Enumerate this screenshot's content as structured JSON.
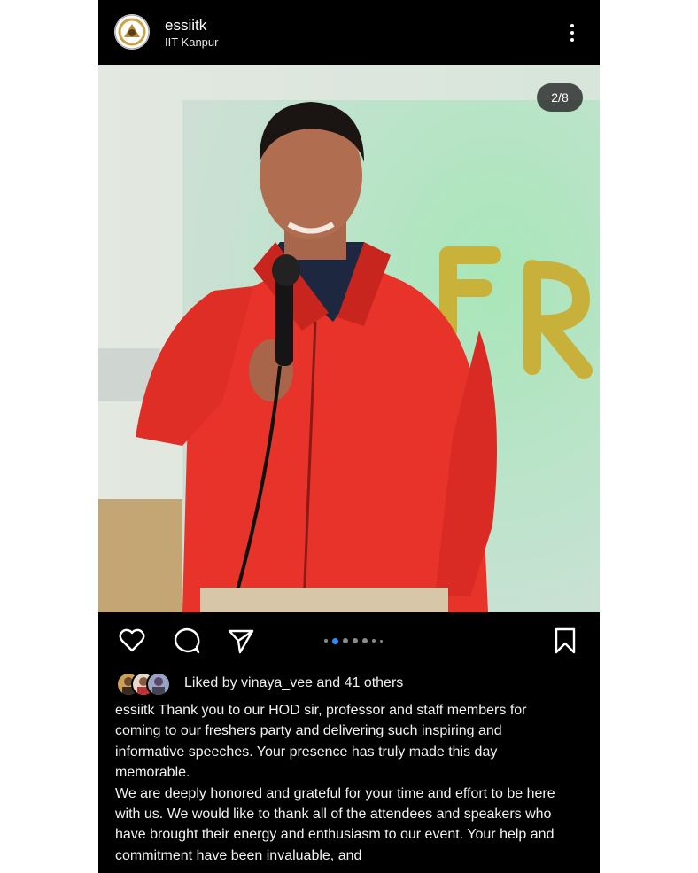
{
  "post": {
    "username": "essiitk",
    "location": "IIT Kanpur",
    "slide_counter": "2/8",
    "carousel": {
      "total": 8,
      "current": 2
    },
    "liked_by": "Liked by vinaya_vee and 41 others",
    "caption_user": "essiitk",
    "caption_line1": "Thank you to our HOD sir, professor and staff members for coming to our freshers party and delivering such inspiring and informative speeches. Your presence has truly made this day memorable.",
    "caption_line2": "We are deeply honored and grateful for your time and effort to be here with us. We would like to thank all of the attendees and speakers who have brought their energy and enthusiasm to our event. Your help and commitment have been invaluable, and"
  },
  "icons": {
    "more": "more-vertical-icon",
    "like": "heart-icon",
    "comment": "comment-icon",
    "share": "send-icon",
    "save": "bookmark-icon"
  },
  "colors": {
    "background": "#000000",
    "text": "#f5f5f5",
    "active_dot": "#2d8cff",
    "jacket": "#e8332a"
  }
}
